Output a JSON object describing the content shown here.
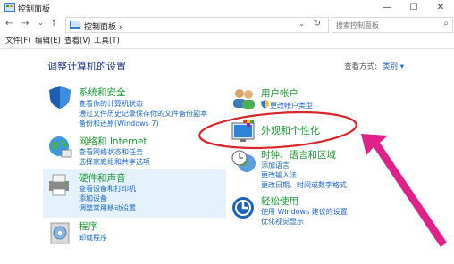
{
  "window": {
    "title": "控制面板",
    "minimize": "—",
    "maximize": "☐",
    "close": "✕"
  },
  "nav": {
    "back": "←",
    "forward": "→",
    "dropdown": "⌄",
    "up": "↑",
    "breadcrumb": "控制面板  ›",
    "addr_dropdown": "⌄",
    "refresh": "↻",
    "search_placeholder": "搜索控制面板",
    "search_icon": "⌕"
  },
  "menu": {
    "file": "文件(F)",
    "edit": "编辑(E)",
    "view": "查看(V)",
    "tools": "工具(T)"
  },
  "main": {
    "heading": "调整计算机的设置",
    "view_by_label": "查看方式:",
    "view_by_value": "类别 ▾"
  },
  "categories": {
    "system": {
      "title": "系统和安全",
      "links": [
        "查看你的计算机状态",
        "通过文件历史记录保存你的文件备份副本",
        "备份和还原(Windows 7)"
      ]
    },
    "network": {
      "title": "网络和 Internet",
      "links": [
        "查看网络状态和任务",
        "选择家庭组和共享选项"
      ]
    },
    "hardware": {
      "title": "硬件和声音",
      "links": [
        "查看设备和打印机",
        "添加设备",
        "调整常用移动设置"
      ]
    },
    "programs": {
      "title": "程序",
      "links": [
        "卸载程序"
      ]
    },
    "user": {
      "title": "用户帐户",
      "links": [
        "更改帐户类型"
      ]
    },
    "appearance": {
      "title": "外观和个性化",
      "links": []
    },
    "clock": {
      "title": "时钟、语言和区域",
      "links": [
        "添加语言",
        "更改输入法",
        "更改日期、时间或数字格式"
      ]
    },
    "ease": {
      "title": "轻松使用",
      "links": [
        "使用 Windows 建议的设置",
        "优化视觉显示"
      ]
    }
  },
  "colors": {
    "accent": "#1a66c8",
    "title_green": "#1a9b34",
    "annotation": "#e0218a",
    "heading": "#1e3287"
  }
}
